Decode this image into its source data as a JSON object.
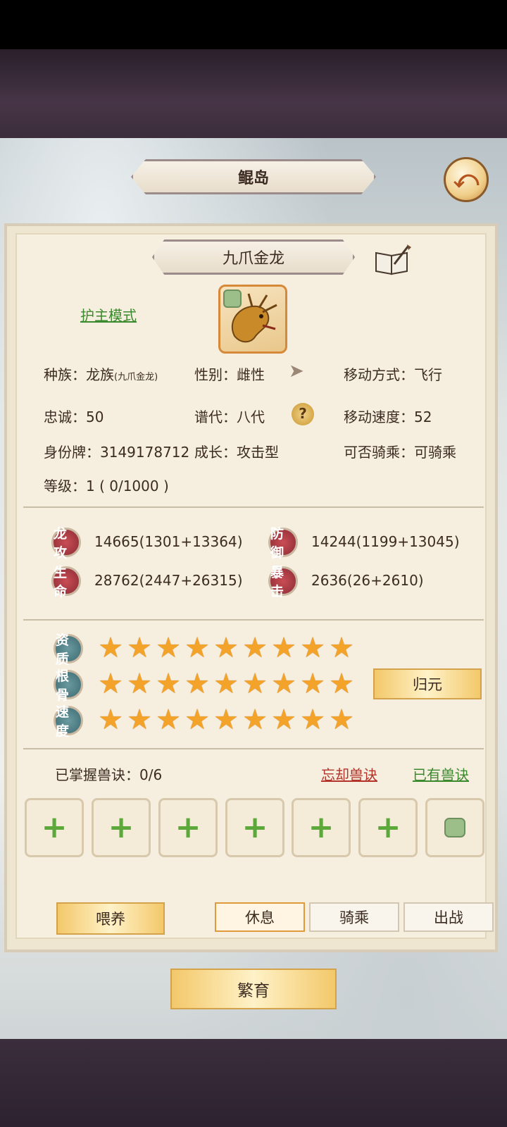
{
  "header": {
    "title": "鲲岛"
  },
  "pet": {
    "name": "九爪金龙",
    "guard_mode_link": "护主模式",
    "race_label": "种族：",
    "race_value": "龙族",
    "race_sub": "(九爪金龙)",
    "gender_label": "性别：",
    "gender_value": "雌性",
    "move_mode_label": "移动方式：",
    "move_mode_value": "飞行",
    "loyalty_label": "忠诚：",
    "loyalty_value": "50",
    "generation_label": "谱代：",
    "generation_value": "八代",
    "move_speed_label": "移动速度：",
    "move_speed_value": "52",
    "id_label": "身份牌：",
    "id_value": "3149178712",
    "growth_label": "成长：",
    "growth_value": "攻击型",
    "rideable_label": "可否骑乘：",
    "rideable_value": "可骑乘",
    "level_label": "等级：",
    "level_value": "1 ( 0/1000 )"
  },
  "stats": [
    {
      "label": "龙攻",
      "value": "14665(1301+13364)"
    },
    {
      "label": "防御",
      "value": "14244(1199+13045)"
    },
    {
      "label": "生命",
      "value": "28762(2447+26315)"
    },
    {
      "label": "暴击",
      "value": "2636(26+2610)"
    }
  ],
  "aptitudes": [
    {
      "label": "资质",
      "stars": 9
    },
    {
      "label": "根骨",
      "stars": 9
    },
    {
      "label": "速度",
      "stars": 9
    }
  ],
  "reset_button": "归元",
  "skills": {
    "mastered_label": "已掌握兽诀：0/6",
    "forget_link": "忘却兽诀",
    "owned_link": "已有兽诀",
    "slot_symbol": "+"
  },
  "actions": {
    "feed": "喂养",
    "rest": "休息",
    "ride": "骑乘",
    "battle": "出战",
    "breed": "繁育"
  },
  "colors": {
    "accent_gold": "#f3c86a",
    "link_green": "#3c8a2e",
    "link_red": "#b3322a",
    "star": "#f3a22a"
  }
}
